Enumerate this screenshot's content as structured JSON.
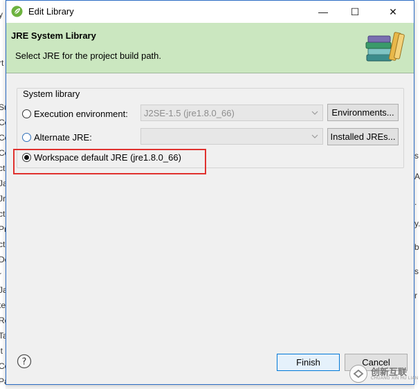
{
  "window": {
    "title": "Edit Library",
    "minimize_glyph": "—",
    "maximize_glyph": "☐",
    "close_glyph": "✕"
  },
  "header": {
    "title": "JRE System Library",
    "description": "Select JRE for the project build path."
  },
  "group": {
    "label": "System library",
    "execution": {
      "label": "Execution environment:",
      "value": "J2SE-1.5 (jre1.8.0_66)",
      "button": "Environments..."
    },
    "alternate": {
      "label": "Alternate JRE:",
      "value": "",
      "button": "Installed JREs..."
    },
    "workspace": {
      "label": "Workspace default JRE (jre1.8.0_66)"
    },
    "selected": "workspace"
  },
  "footer": {
    "finish": "Finish",
    "cancel": "Cancel"
  },
  "background": {
    "left_fragments": [
      "y",
      "rt",
      "Su",
      "Co",
      "Co",
      "Co",
      "ct",
      "Ja",
      "Jr",
      "ct",
      "Pr",
      "ct",
      "De",
      "r",
      "Ja",
      "te",
      "Re",
      "Ta",
      "it",
      "Co",
      "Pa"
    ],
    "right_fragments": [
      "s",
      "A",
      ".",
      "y.",
      "b",
      "s",
      "r"
    ]
  },
  "watermark": {
    "cn": "创新互联",
    "en": "CHUANG XIN HU LIAN"
  },
  "colors": {
    "header_bg": "#cbe7c0",
    "highlight": "#e0312e",
    "accent": "#0078d7"
  }
}
